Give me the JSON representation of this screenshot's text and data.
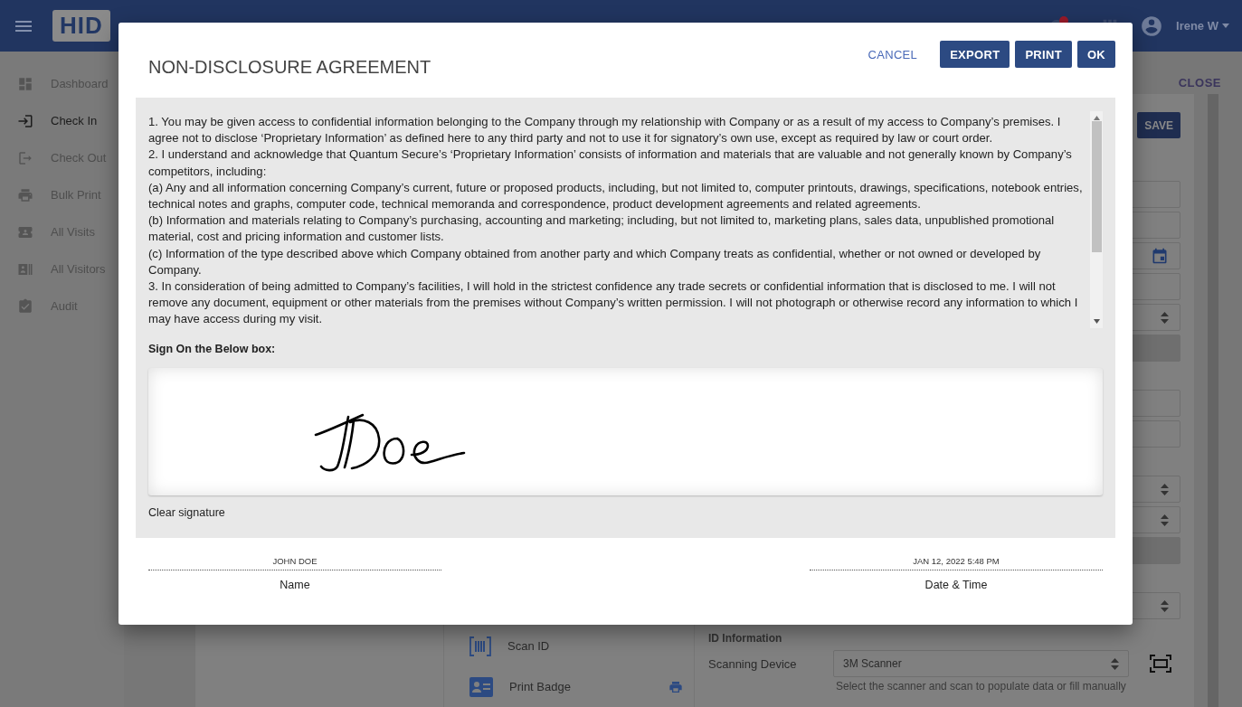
{
  "header": {
    "logo": "HID",
    "user": "Irene W",
    "has_notification": true
  },
  "sidebar": {
    "items": [
      {
        "label": "Dashboard",
        "kind": "dashboard",
        "selected": false
      },
      {
        "label": "Check In",
        "kind": "checkin",
        "selected": true
      },
      {
        "label": "Check Out",
        "kind": "checkout",
        "selected": false
      },
      {
        "label": "Bulk Print",
        "kind": "print",
        "selected": false
      },
      {
        "label": "All Visits",
        "kind": "visits",
        "selected": false
      },
      {
        "label": "All Visitors",
        "kind": "visitors",
        "selected": false
      },
      {
        "label": "Audit",
        "kind": "audit",
        "selected": false
      }
    ]
  },
  "page": {
    "close": "CLOSE",
    "save": "SAVE"
  },
  "form": {
    "field_groups": [
      [
        {
          "kind": "text"
        },
        {
          "kind": "text"
        },
        {
          "kind": "date"
        },
        {
          "kind": "text"
        },
        {
          "kind": "select"
        },
        {
          "kind": "disabled"
        }
      ],
      [
        {
          "kind": "text"
        },
        {
          "kind": "text"
        }
      ],
      [
        {
          "kind": "select"
        },
        {
          "kind": "select"
        },
        {
          "kind": "disabled"
        }
      ],
      [
        {
          "kind": "select"
        }
      ]
    ]
  },
  "actions": [
    {
      "label": "Scan ID",
      "kind": "scan"
    },
    {
      "label": "Print Badge",
      "kind": "badge"
    }
  ],
  "id_section": {
    "heading": "ID Information",
    "device_label": "Scanning Device",
    "device_value": "3M Scanner",
    "hint": "Select the scanner and scan to populate data or fill manually"
  },
  "dialog": {
    "title": "NON-DISCLOSURE AGREEMENT",
    "buttons": [
      {
        "label": "CANCEL",
        "kind": "text"
      },
      {
        "label": "EXPORT",
        "kind": "filled"
      },
      {
        "label": "PRINT",
        "kind": "filled"
      },
      {
        "label": "OK",
        "kind": "filled"
      }
    ],
    "agreement": [
      "1. You may be given access to confidential information belonging to the Company through my relationship with Company or as a result of my access to Company’s premises. I agree not to disclose ‘Proprietary Information’ as defined here to any third party and not to use it for signatory’s own use, except as required by law or court order.",
      "2. I understand and acknowledge that Quantum Secure’s ‘Proprietary Information’ consists of information and materials that are valuable and not generally known by Company’s competitors, including:",
      "(a) Any and all information concerning Company’s current, future or proposed products, including, but not limited to, computer printouts, drawings, specifications, notebook entries, technical notes and graphs, computer code, technical memoranda and correspondence, product development agreements and related agreements.",
      "(b) Information and materials relating to Company’s purchasing, accounting and marketing; including, but not limited to, marketing plans, sales data, unpublished promotional material, cost and pricing information and customer lists.",
      "(c) Information of the type described above which Company obtained from another party and which Company treats as confidential, whether or not owned or developed by Company.",
      "3. In consideration of being admitted to Company’s facilities, I will hold in the strictest confidence any trade secrets or confidential information that is disclosed to me. I will not remove any document, equipment or other materials from the premises without Company’s written permission. I will not photograph or otherwise record any information to which I may have access during my visit."
    ],
    "sign_prompt": "Sign On the Below box:",
    "clear_label": "Clear signature",
    "signed": true,
    "signer": {
      "value": "JOHN DOE",
      "label": "Name"
    },
    "datetime": {
      "value": "JAN 12, 2022 5:48 PM",
      "label": "Date & Time"
    }
  }
}
